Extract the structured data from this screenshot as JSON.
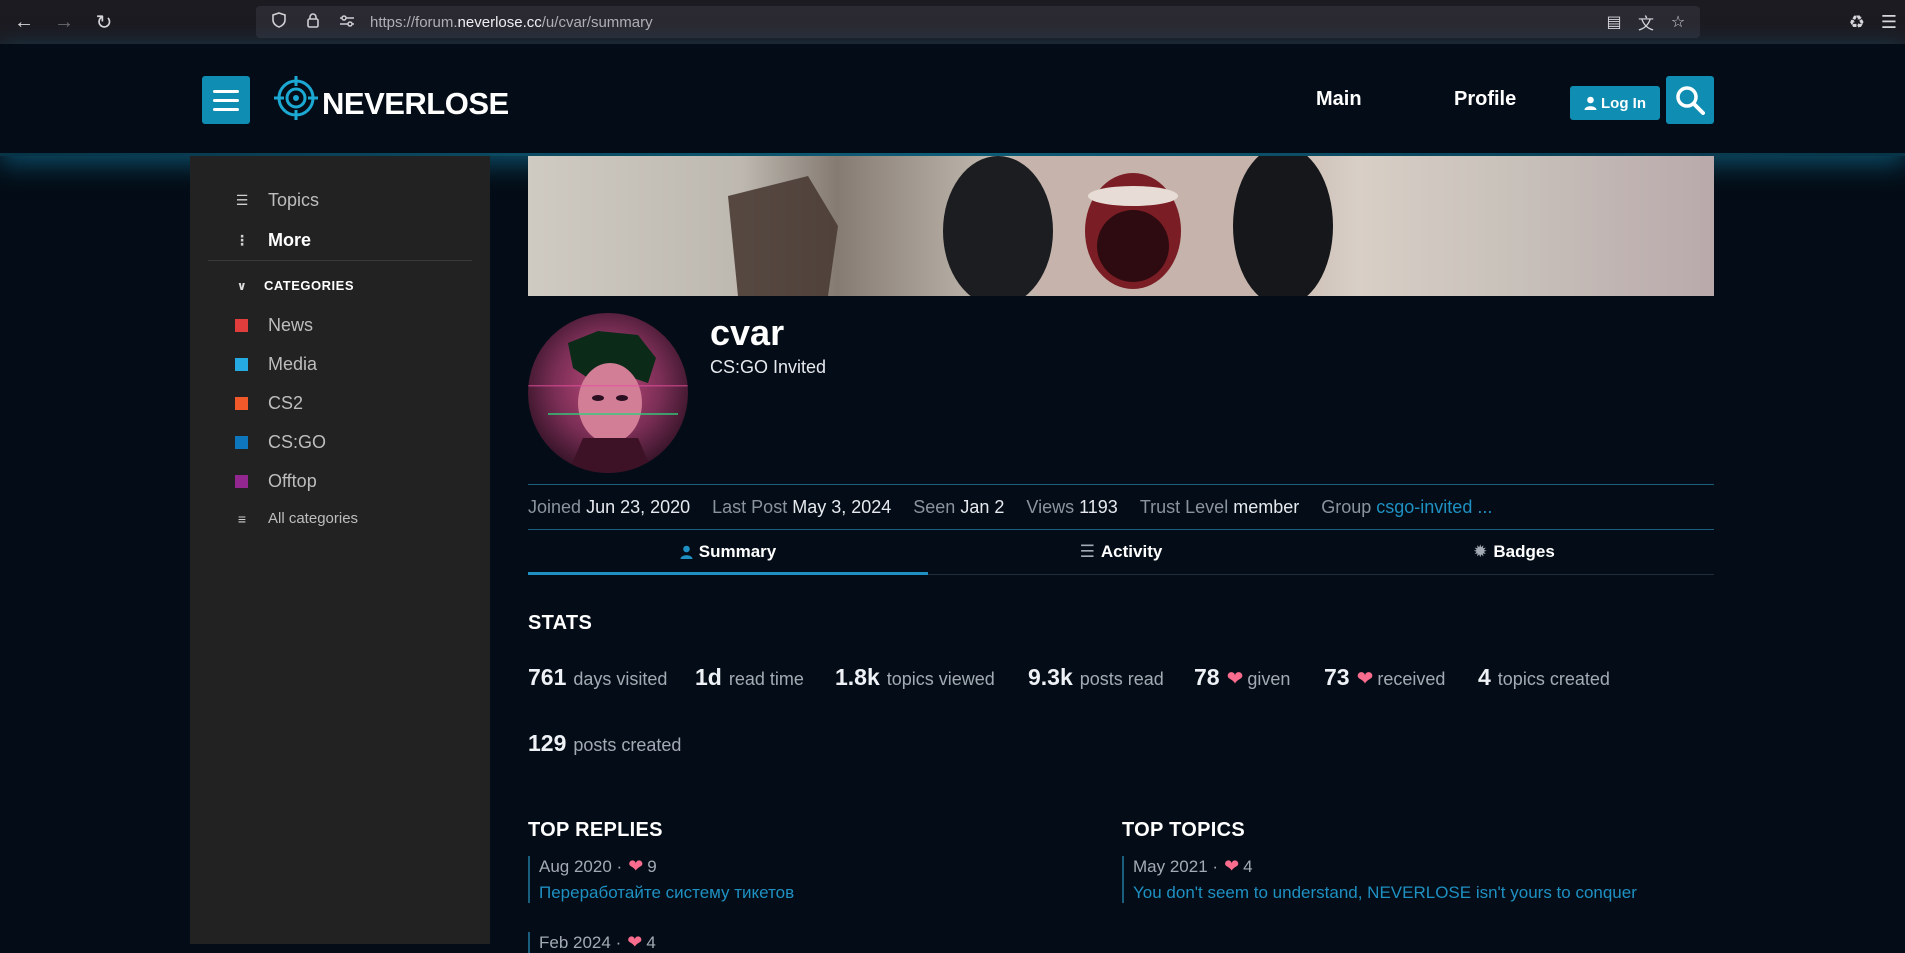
{
  "browser": {
    "url_prefix": "https://forum.",
    "url_domain": "neverlose.cc",
    "url_path": "/u/cvar/summary"
  },
  "header": {
    "logo_text": "NEVERLOSE",
    "nav": [
      "Main",
      "Profile"
    ],
    "login_label": "Log In"
  },
  "sidebar": {
    "topics_label": "Topics",
    "more_label": "More",
    "categories_label": "CATEGORIES",
    "categories": [
      {
        "label": "News",
        "color": "#e23d3d"
      },
      {
        "label": "Media",
        "color": "#25aae1"
      },
      {
        "label": "CS2",
        "color": "#f1592a"
      },
      {
        "label": "CS:GO",
        "color": "#0e76bd"
      },
      {
        "label": "Offtop",
        "color": "#92278f"
      }
    ],
    "all_categories_label": "All categories"
  },
  "profile": {
    "username": "cvar",
    "title": "CS:GO Invited",
    "meta": {
      "joined_label": "Joined",
      "joined": "Jun 23, 2020",
      "last_post_label": "Last Post",
      "last_post": "May 3, 2024",
      "seen_label": "Seen",
      "seen": "Jan 2",
      "views_label": "Views",
      "views": "1193",
      "trust_label": "Trust Level",
      "trust": "member",
      "group_label": "Group",
      "group": "csgo-invited ..."
    },
    "tabs": [
      "Summary",
      "Activity",
      "Badges"
    ]
  },
  "stats": {
    "title": "STATS",
    "items": [
      {
        "num": "761",
        "label": "days visited"
      },
      {
        "num": "1d",
        "label": "read time"
      },
      {
        "num": "1.8k",
        "label": "topics viewed"
      },
      {
        "num": "9.3k",
        "label": "posts read"
      },
      {
        "num": "78",
        "label": "given"
      },
      {
        "num": "73",
        "label": "received"
      },
      {
        "num": "4",
        "label": "topics created"
      },
      {
        "num": "129",
        "label": "posts created"
      }
    ]
  },
  "top_replies": {
    "title": "TOP REPLIES",
    "items": [
      {
        "date": "Aug 2020",
        "likes": "9",
        "title": "Переработайте систему тикетов"
      },
      {
        "date": "Feb 2024",
        "likes": "4",
        "title": ""
      }
    ]
  },
  "top_topics": {
    "title": "TOP TOPICS",
    "items": [
      {
        "date": "May 2021",
        "likes": "4",
        "title": "You don't seem to understand, NEVERLOSE isn't yours to conquer"
      }
    ]
  }
}
